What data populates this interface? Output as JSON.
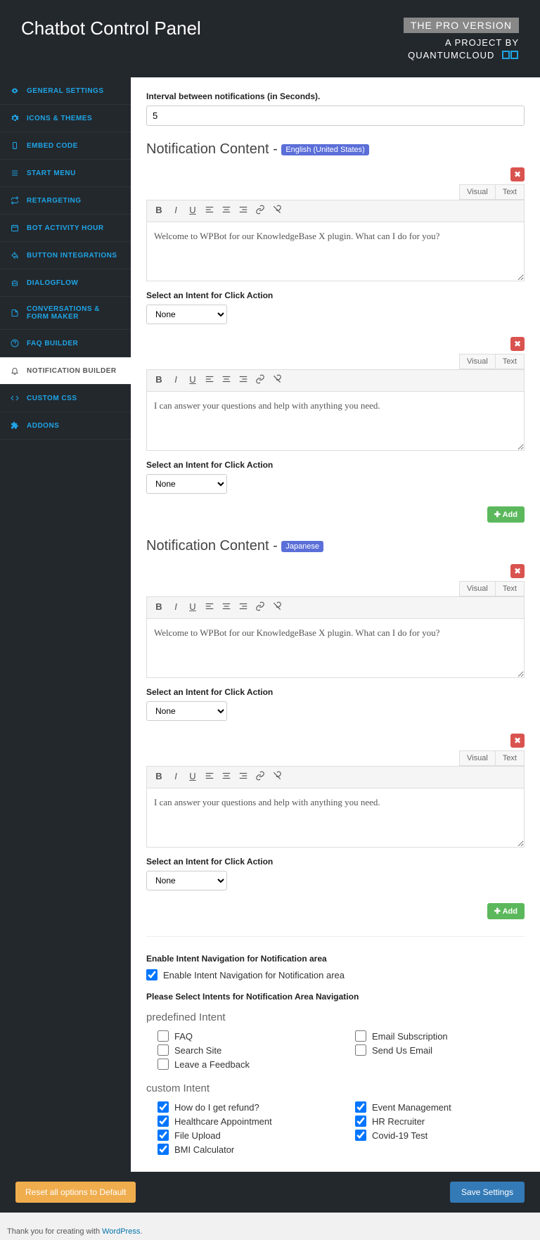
{
  "header": {
    "title": "Chatbot Control Panel",
    "pro": "THE PRO VERSION",
    "project_line1": "A PROJECT BY",
    "project_line2": "QUANTUMCLOUD"
  },
  "sidebar": {
    "items": [
      {
        "label": "GENERAL SETTINGS",
        "icon": "eye"
      },
      {
        "label": "ICONS & THEMES",
        "icon": "gear"
      },
      {
        "label": "EMBED CODE",
        "icon": "mobile"
      },
      {
        "label": "START MENU",
        "icon": "bars"
      },
      {
        "label": "RETARGETING",
        "icon": "retweet"
      },
      {
        "label": "BOT ACTIVITY HOUR",
        "icon": "calendar"
      },
      {
        "label": "BUTTON INTEGRATIONS",
        "icon": "share"
      },
      {
        "label": "DIALOGFLOW",
        "icon": "robot"
      },
      {
        "label": "CONVERSATIONS & FORM MAKER",
        "icon": "file"
      },
      {
        "label": "FAQ BUILDER",
        "icon": "question"
      },
      {
        "label": "NOTIFICATION BUILDER",
        "icon": "bell",
        "active": true
      },
      {
        "label": "CUSTOM CSS",
        "icon": "code"
      },
      {
        "label": "ADDONS",
        "icon": "puzzle"
      }
    ]
  },
  "interval": {
    "label": "Interval between notifications (in Seconds).",
    "value": "5"
  },
  "sections": {
    "en": {
      "title": "Notification Content - ",
      "lang": "English (United States)",
      "items": [
        {
          "text": "Welcome to WPBot for our KnowledgeBase X plugin. What can I do for you?",
          "intent": "None"
        },
        {
          "text": "I can answer your questions and help with anything you need.",
          "intent": "None"
        }
      ]
    },
    "jp": {
      "title": "Notification Content - ",
      "lang": "Japanese",
      "items": [
        {
          "text": "Welcome to WPBot for our KnowledgeBase X plugin. What can I do for you?",
          "intent": "None"
        },
        {
          "text": "I can answer your questions and help with anything you need.",
          "intent": "None"
        }
      ]
    }
  },
  "intent_label": "Select an Intent for Click Action",
  "editor_tabs": {
    "visual": "Visual",
    "text": "Text"
  },
  "add_label": "Add",
  "enable_nav": {
    "heading": "Enable Intent Navigation for Notification area",
    "checkbox": "Enable Intent Navigation for Notification area",
    "checked": true
  },
  "select_intents_heading": "Please Select Intents for Notification Area Navigation",
  "predefined": {
    "title": "predefined Intent",
    "left": [
      {
        "label": "FAQ",
        "checked": false
      },
      {
        "label": "Search Site",
        "checked": false
      },
      {
        "label": "Leave a Feedback",
        "checked": false
      }
    ],
    "right": [
      {
        "label": "Email Subscription",
        "checked": false
      },
      {
        "label": "Send Us Email",
        "checked": false
      }
    ]
  },
  "custom": {
    "title": "custom Intent",
    "left": [
      {
        "label": "How do I get refund?",
        "checked": true
      },
      {
        "label": "Healthcare Appointment",
        "checked": true
      },
      {
        "label": "File Upload",
        "checked": true
      },
      {
        "label": "BMI Calculator",
        "checked": true
      }
    ],
    "right": [
      {
        "label": "Event Management",
        "checked": true
      },
      {
        "label": "HR Recruiter",
        "checked": true
      },
      {
        "label": "Covid-19 Test",
        "checked": true
      }
    ]
  },
  "footer": {
    "reset": "Reset all options to Default",
    "save": "Save Settings"
  },
  "wp_footer": {
    "text": "Thank you for creating with ",
    "link": "WordPress"
  }
}
